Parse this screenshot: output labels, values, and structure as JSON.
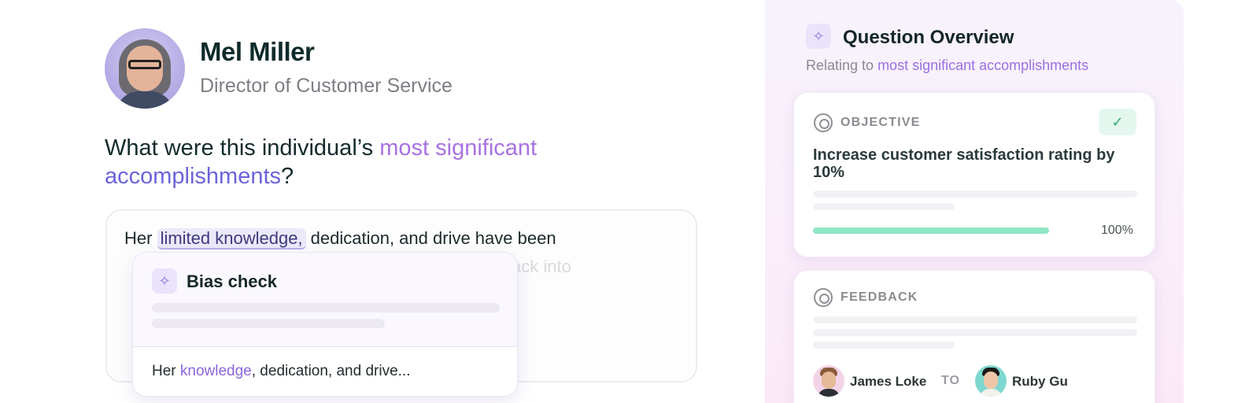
{
  "profile": {
    "name": "Mel Miller",
    "role": "Director of Customer Service"
  },
  "question": {
    "prefix": "What were this individual’s ",
    "highlight": "most significant",
    "highlight2": "accomplishments",
    "suffix": "?"
  },
  "answer": {
    "before": "Her ",
    "flagged": "limited knowledge,",
    "after": " dedication, and drive have been",
    "faded_tail": "ack into"
  },
  "bias_check": {
    "title": "Bias check",
    "icon": "sparkle-icon",
    "suggestion_before": "Her ",
    "suggestion_keyword": "knowledge",
    "suggestion_after": ", dedication, and drive..."
  },
  "overview": {
    "title": "Question Overview",
    "icon": "sparkle-icon",
    "subtitle_prefix": "Relating to ",
    "subtitle_keyword": "most significant accomplishments"
  },
  "objective": {
    "label": "OBJECTIVE",
    "icon": "target-icon",
    "text": "Increase customer satisfaction rating by 10%",
    "progress": 1.0,
    "progress_label": "100%",
    "status_icon": "check-icon"
  },
  "feedback": {
    "label": "FEEDBACK",
    "icon": "target-icon",
    "from": "James Loke",
    "to_label": "TO",
    "to": "Ruby Gu"
  },
  "colors": {
    "accent_purple": "#a871e2",
    "accent_indigo": "#6b63d9",
    "success_green": "#8fe6c4"
  }
}
